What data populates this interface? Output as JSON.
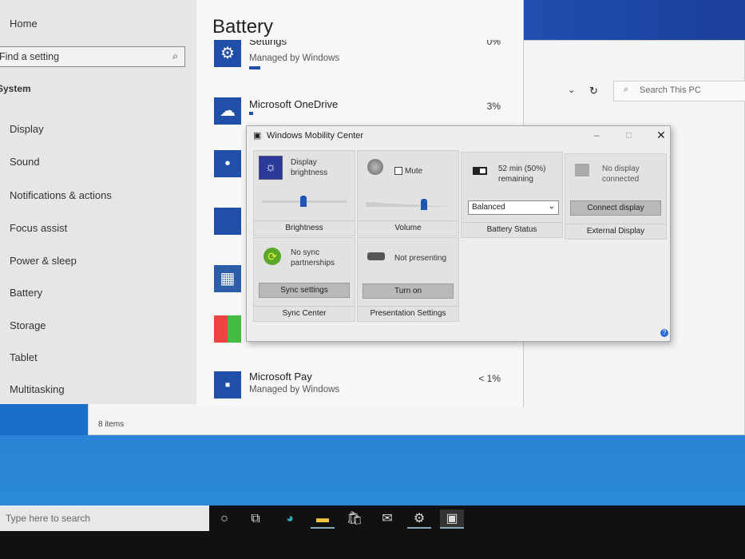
{
  "settings": {
    "nav": {
      "home": "Home",
      "search_placeholder": "Find a setting",
      "section": "System",
      "items": [
        "Display",
        "Sound",
        "Notifications & actions",
        "Focus assist",
        "Power & sleep",
        "Battery",
        "Storage",
        "Tablet",
        "Multitasking"
      ]
    },
    "title": "Battery",
    "apps": [
      {
        "name": "Settings",
        "sub": "Managed by Windows",
        "pct": "0%"
      },
      {
        "name": "Microsoft OneDrive",
        "sub": "",
        "pct": "3%"
      },
      {
        "name": "Microsoft Pay",
        "sub": "Managed by Windows",
        "pct": "< 1%"
      }
    ]
  },
  "explorer": {
    "search_placeholder": "Search This PC",
    "status": "8 items"
  },
  "wmc": {
    "title": "Windows Mobility Center",
    "brightness": {
      "text": "Display brightness",
      "label": "Brightness",
      "value": 0.45
    },
    "volume": {
      "mute": "Mute",
      "label": "Volume",
      "value": 0.65
    },
    "battery": {
      "text": "52 min (50%) remaining",
      "plan": "Balanced",
      "label": "Battery Status"
    },
    "display": {
      "text": "No display connected",
      "button": "Connect display",
      "label": "External Display"
    },
    "sync": {
      "text": "No sync partnerships",
      "button": "Sync settings",
      "label": "Sync Center"
    },
    "presentation": {
      "text": "Not presenting",
      "button": "Turn on",
      "label": "Presentation Settings"
    }
  },
  "taskbar": {
    "search_placeholder": "Type here to search"
  }
}
